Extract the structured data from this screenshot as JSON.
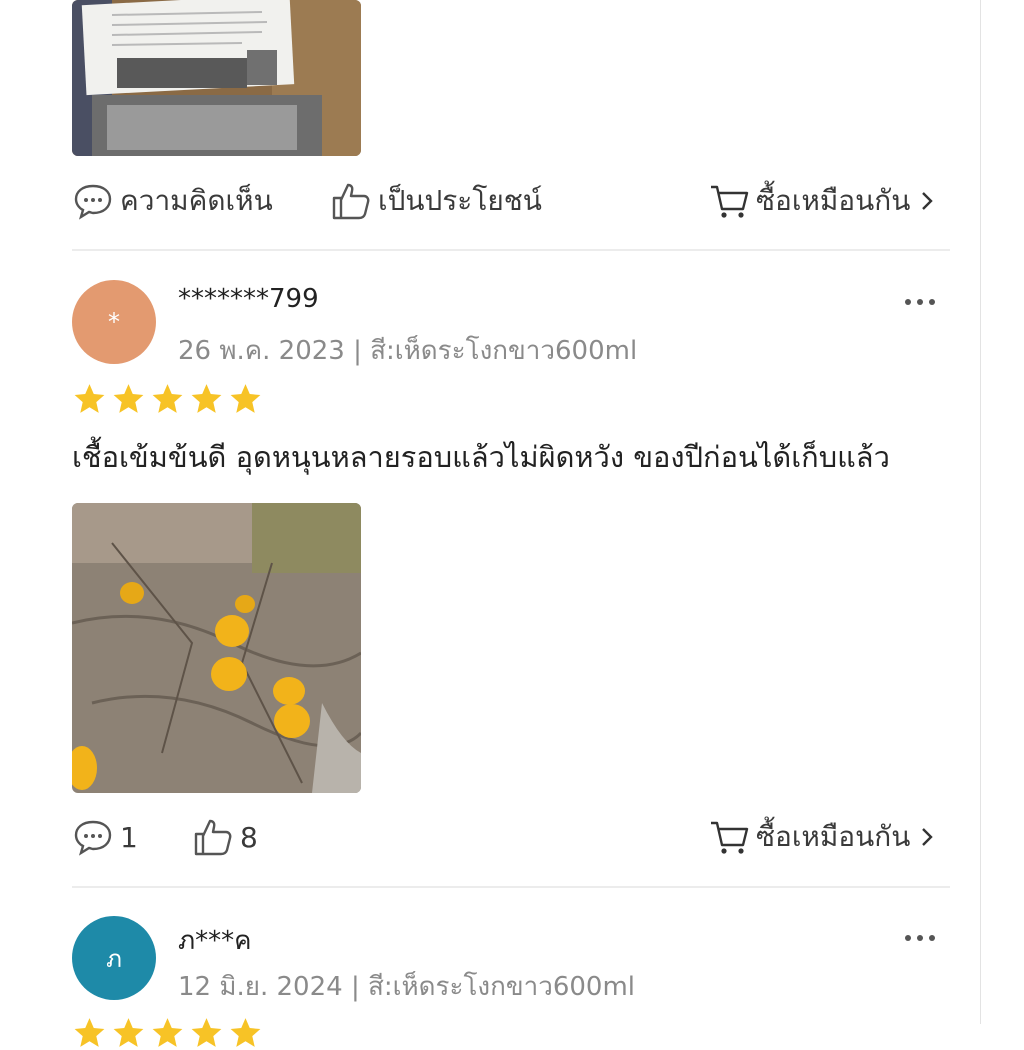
{
  "top_review": {
    "actions": {
      "comment_label": "ความคิดเห็น",
      "helpful_label": "เป็นประโยชน์",
      "buy_same_label": "ซื้อเหมือนกัน"
    }
  },
  "reviews": [
    {
      "avatar_letter": "*",
      "avatar_color": "#E39A70",
      "username": "*******799",
      "date": "26 พ.ค. 2023",
      "variant": "สี:เห็ดระโงกขาว600ml",
      "rating": 5,
      "text": "เชื้อเข้มข้นดี อุดหนุนหลายรอบแล้วไม่ผิดหวัง ของปีก่อนได้เก็บแล้ว",
      "comment_count": "1",
      "helpful_count": "8",
      "buy_same_label": "ซื้อเหมือนกัน"
    },
    {
      "avatar_letter": "ภ",
      "avatar_color": "#1E8AA8",
      "username": "ภ***ค",
      "date": "12 มิ.ย. 2024",
      "variant": "สี:เห็ดระโงกขาว600ml",
      "rating": 5
    }
  ],
  "colors": {
    "star": "#F7C326",
    "divider": "#ececec",
    "meta_text": "#8a8a8a"
  },
  "icons": [
    "comment-icon",
    "thumbs-up-icon",
    "cart-icon",
    "chevron-right-icon",
    "more-icon",
    "star-icon"
  ]
}
